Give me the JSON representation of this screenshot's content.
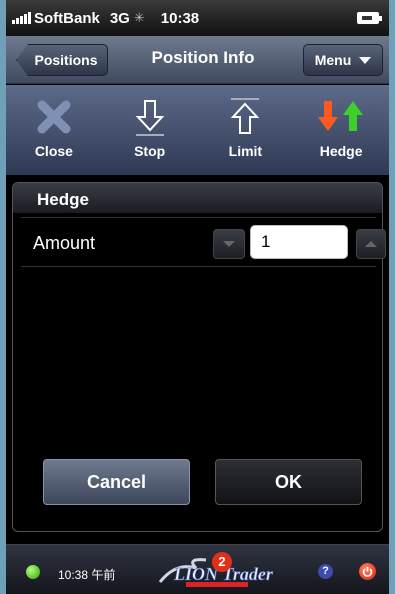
{
  "status_bar": {
    "carrier": "SoftBank",
    "network": "3G",
    "time": "10:38"
  },
  "nav": {
    "back_label": "Positions",
    "title": "Position Info",
    "menu_label": "Menu"
  },
  "toolbar": {
    "items": [
      {
        "label": "Close",
        "icon": "close-x-icon"
      },
      {
        "label": "Stop",
        "icon": "down-arrow-icon"
      },
      {
        "label": "Limit",
        "icon": "up-arrow-icon"
      },
      {
        "label": "Hedge",
        "icon": "hedge-arrows-icon"
      }
    ]
  },
  "dialog": {
    "title": "Hedge",
    "amount_label": "Amount",
    "amount_value": "1",
    "cancel_label": "Cancel",
    "ok_label": "OK"
  },
  "bottom_bar": {
    "time": "10:38 午前",
    "logo_badge": "2",
    "logo_text": "LION Trader",
    "help": "?"
  },
  "colors": {
    "close_icon": "#7f8fb0",
    "hedge_down": "#ff5a1e",
    "hedge_up": "#3bd02a"
  }
}
